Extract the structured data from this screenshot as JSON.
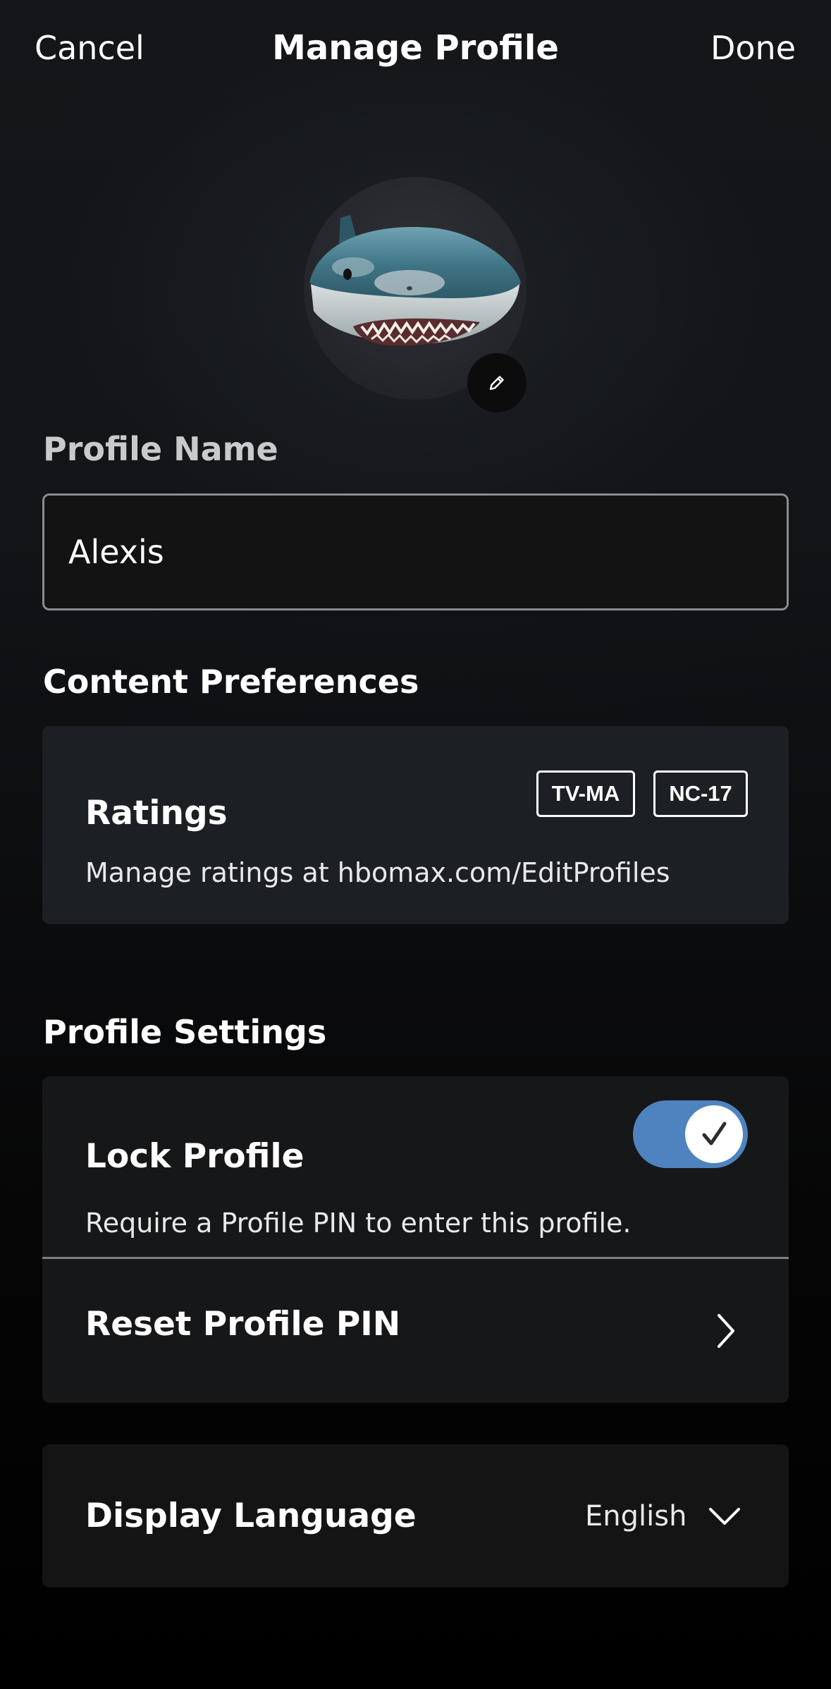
{
  "header": {
    "cancel_label": "Cancel",
    "title": "Manage Profile",
    "done_label": "Done"
  },
  "avatar": {
    "image": "shark-avatar",
    "edit_icon": "pencil-icon"
  },
  "profile_name": {
    "label": "Profile Name",
    "value": "Alexis"
  },
  "content_preferences": {
    "heading": "Content Preferences",
    "ratings": {
      "title": "Ratings",
      "badges": [
        "TV-MA",
        "NC-17"
      ],
      "description": "Manage ratings at hbomax.com/EditProfiles"
    }
  },
  "profile_settings": {
    "heading": "Profile Settings",
    "lock_profile": {
      "title": "Lock Profile",
      "description": "Require a Profile PIN to enter this profile.",
      "enabled": true,
      "toggle_color": "#4e83bf"
    },
    "reset_pin": {
      "title": "Reset Profile PIN",
      "icon": "chevron-right-icon"
    }
  },
  "display_language": {
    "title": "Display Language",
    "value": "English",
    "icon": "chevron-down-icon"
  }
}
